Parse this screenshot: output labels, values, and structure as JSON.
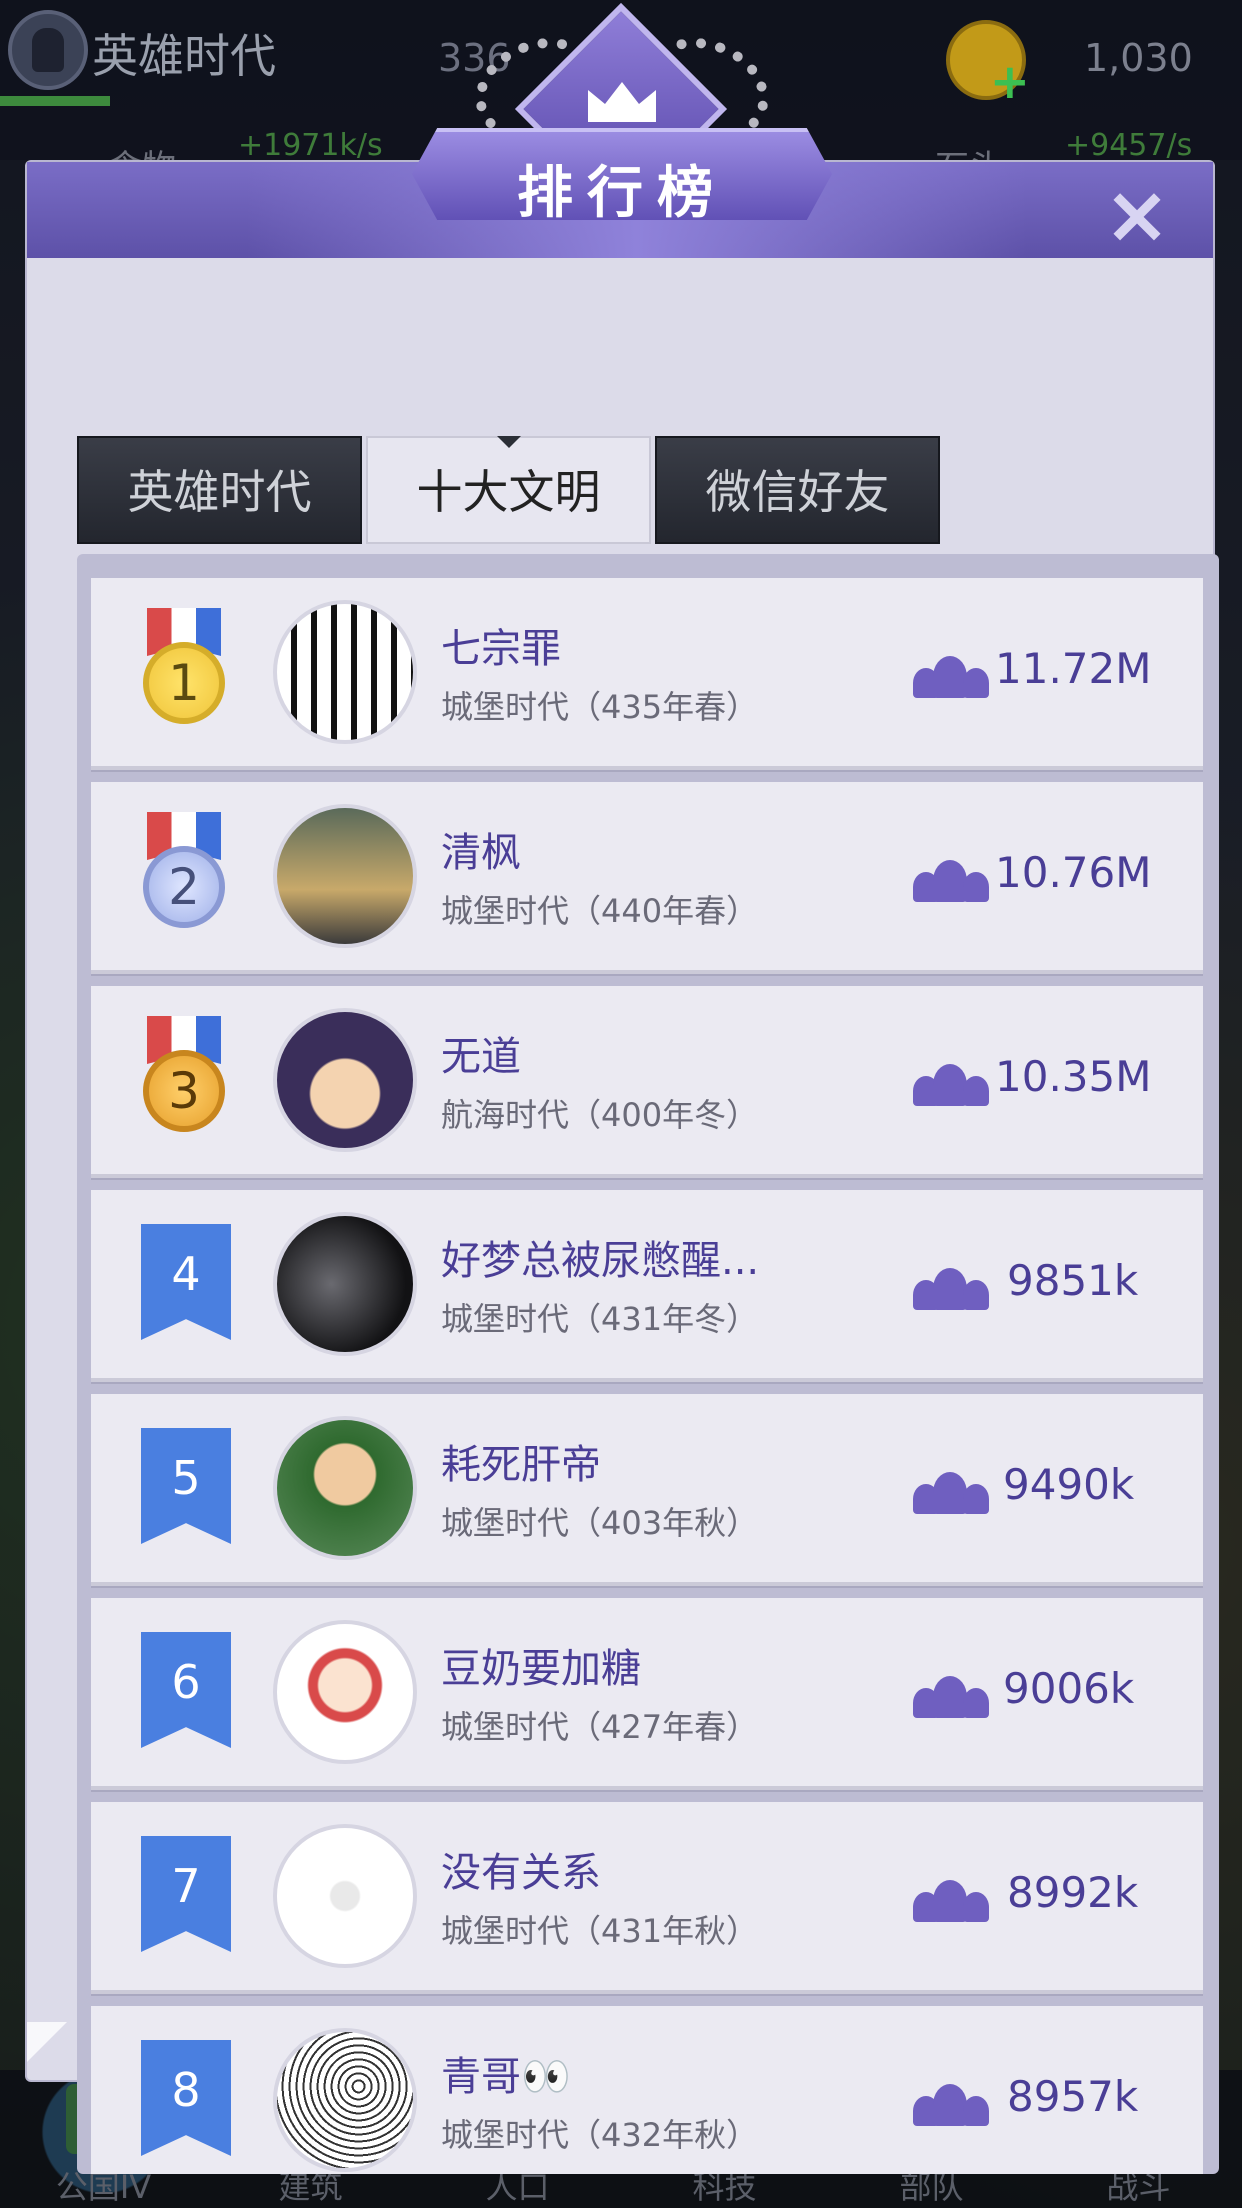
{
  "hud": {
    "era": "英雄时代",
    "mid_value": "336",
    "gold": "1,030",
    "food_label": "食物",
    "food_rate": "+1971k/s",
    "stone_label": "石头",
    "stone_rate": "+9457/s"
  },
  "panel": {
    "title": "排行榜",
    "close_icon": "×",
    "tabs": [
      "英雄时代",
      "十大文明",
      "微信好友"
    ],
    "active_tab": 1
  },
  "rankings": [
    {
      "rank": "1",
      "name": "七宗罪",
      "era": "城堡时代（435年春）",
      "population": "11.72M"
    },
    {
      "rank": "2",
      "name": "清枫",
      "era": "城堡时代（440年春）",
      "population": "10.76M"
    },
    {
      "rank": "3",
      "name": "无道",
      "era": "航海时代（400年冬）",
      "population": "10.35M"
    },
    {
      "rank": "4",
      "name": "好梦总被尿憋醒...",
      "era": "城堡时代（431年冬）",
      "population": "9851k"
    },
    {
      "rank": "5",
      "name": "耗死肝帝",
      "era": "城堡时代（403年秋）",
      "population": "9490k"
    },
    {
      "rank": "6",
      "name": "豆奶要加糖",
      "era": "城堡时代（427年春）",
      "population": "9006k"
    },
    {
      "rank": "7",
      "name": "没有关系",
      "era": "城堡时代（431年秋）",
      "population": "8992k"
    },
    {
      "rank": "8",
      "name": "青哥👀",
      "era": "城堡时代（432年秋）",
      "population": "8957k"
    }
  ],
  "nav": {
    "items": [
      "公国IV",
      "建筑",
      "人口",
      "科技",
      "部队",
      "战斗"
    ]
  },
  "colors": {
    "accent": "#6f5fc0",
    "rank_flag": "#4a7fe0",
    "name_text": "#4a3e96"
  }
}
